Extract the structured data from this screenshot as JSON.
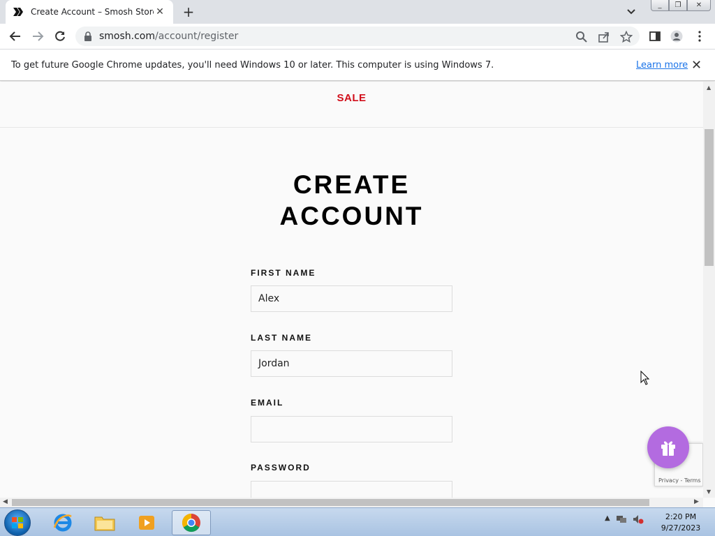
{
  "browser": {
    "tab": {
      "title": "Create Account – Smosh Store"
    },
    "new_tab_symbol": "+",
    "window_buttons": {
      "minimize": "_",
      "maximize": "❐",
      "close": "✕"
    },
    "address": {
      "domain": "smosh.com",
      "path": "/account/register"
    },
    "infobar": {
      "message": "To get future Google Chrome updates, you'll need Windows 10 or later. This computer is using Windows 7.",
      "learn_more": "Learn more",
      "close": "✕"
    }
  },
  "page": {
    "sale_link": "SALE",
    "heading_line1": "CREATE",
    "heading_line2": "ACCOUNT",
    "form": {
      "first_name_label": "FIRST NAME",
      "first_name_value": "Alex",
      "last_name_label": "LAST NAME",
      "last_name_value": "Jordan",
      "email_label": "EMAIL",
      "email_value": "",
      "password_label": "PASSWORD",
      "password_value": ""
    },
    "recaptcha_text": "Privacy - Terms"
  },
  "taskbar": {
    "time": "2:20 PM",
    "date": "9/27/2023"
  },
  "colors": {
    "sale": "#d10f1b",
    "gift_button": "#b36be0",
    "link": "#1a73e8"
  }
}
